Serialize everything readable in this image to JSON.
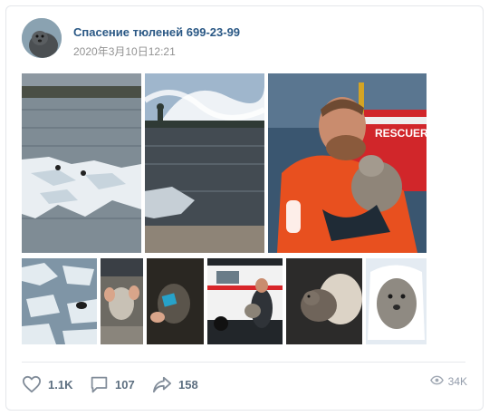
{
  "post": {
    "author": "Спасение тюленей 699-23-99",
    "date": "2020年3月10日12:21"
  },
  "photos": [
    {
      "subject": "icy river with floating ice floes"
    },
    {
      "subject": "river embankment with cloudy sky and cathedral silhouette"
    },
    {
      "subject": "rescuer in orange suit holding a seal pup near a RESCUER boat",
      "caption": "RESCUER"
    },
    {
      "subject": "seal swimming among ice floes"
    },
    {
      "subject": "hands holding seal pup on the ground"
    },
    {
      "subject": "seal with blue tag at night"
    },
    {
      "subject": "rescuer with seal next to ambulance vehicle"
    },
    {
      "subject": "seal pup resting on fabric"
    },
    {
      "subject": "seal pup wrapped in white blanket"
    }
  ],
  "actions": {
    "likes": "1.1K",
    "comments": "107",
    "shares": "158",
    "views": "34K"
  },
  "icons": [
    "heart-icon",
    "comment-icon",
    "share-icon",
    "eye-icon"
  ],
  "colors": {
    "author_link": "#2a5885",
    "action_text": "#5d6f80",
    "rescue_orange": "#e8501f"
  }
}
